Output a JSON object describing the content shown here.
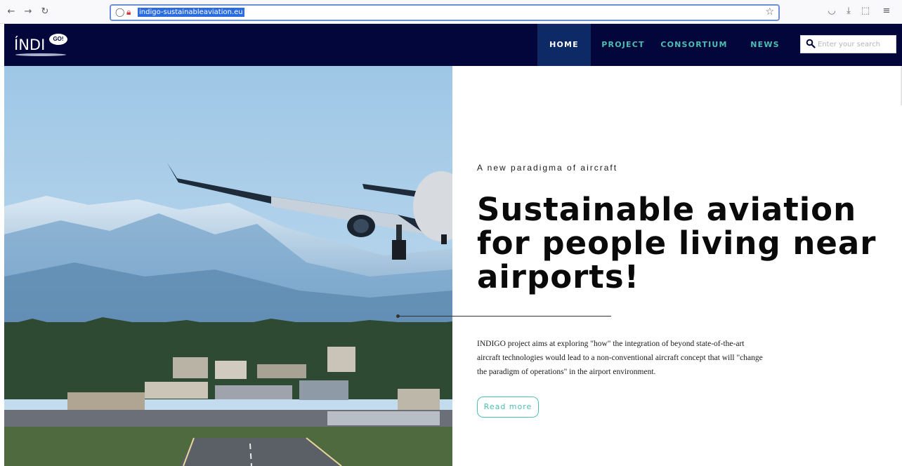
{
  "browser": {
    "url": "indigo-sustainableaviation.eu",
    "icons": [
      "back-icon",
      "forward-icon",
      "reload-icon",
      "shield-icon",
      "lock-icon",
      "bookmark-star-icon",
      "pocket-icon",
      "download-icon",
      "extensions-icon",
      "menu-icon"
    ]
  },
  "header": {
    "logo_text": "ÍNDI",
    "logo_badge": "GO!",
    "nav": [
      {
        "label": "HOME",
        "active": true
      },
      {
        "label": "PROJECT",
        "active": false
      },
      {
        "label": "CONSORTIUM",
        "active": false
      },
      {
        "label": "NEWS",
        "active": false
      }
    ],
    "search": {
      "placeholder": "Enter your search",
      "value": ""
    }
  },
  "hero": {
    "eyebrow": "A new paradigma of aircraft",
    "headline": "Sustainable aviation for people living near airports!",
    "body": "INDIGO project aims at exploring \"how\" the integration of beyond state-of-the-art aircraft technologies would lead to a non-conventional aircraft concept that will \"change the paradigm of operations\" in the airport environment.",
    "cta_label": "Read more"
  },
  "colors": {
    "header_bg": "#03063a",
    "active_nav_bg": "#0d2a66",
    "accent_teal": "#4bbfb2"
  }
}
